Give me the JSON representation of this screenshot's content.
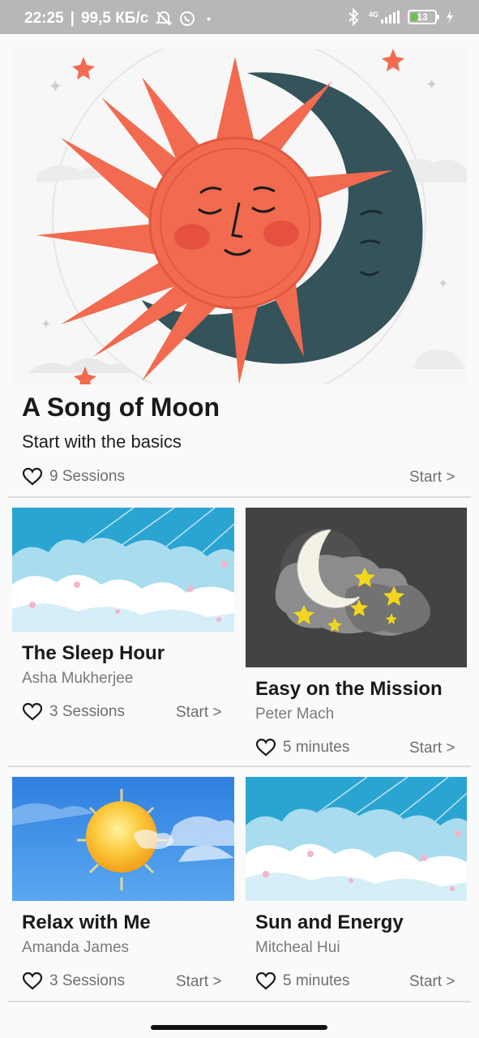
{
  "status_bar": {
    "time": "22:25",
    "speed": "99,5 КБ/с",
    "network": "4G",
    "battery": "13",
    "colors": {
      "bar": "#b7b7b7",
      "battery_fill": "#6cc04a"
    },
    "icons": [
      "silent-bell-icon",
      "whatsapp-icon",
      "bluetooth-icon",
      "signal-icon",
      "battery-icon",
      "charging-icon"
    ]
  },
  "featured": {
    "title": "A Song of Moon",
    "subtitle": "Start with the basics",
    "sessions": "9 Sessions",
    "start": "Start >",
    "image": "sun-and-moon-illustration"
  },
  "cards": [
    {
      "title": "The Sleep Hour",
      "author": "Asha Mukherjee",
      "meta": "3 Sessions",
      "start": "Start >",
      "image": "sky-clouds-illustration"
    },
    {
      "title": "Easy on the Mission",
      "author": "Peter Mach",
      "meta": "5 minutes",
      "start": "Start >",
      "image": "moon-clouds-stars-illustration"
    },
    {
      "title": "Relax with Me",
      "author": "Amanda James",
      "meta": "3 Sessions",
      "start": "Start >",
      "image": "sun-blue-sky-illustration"
    },
    {
      "title": "Sun and Energy",
      "author": "Mitcheal Hui",
      "meta": "5 minutes",
      "start": "Start >",
      "image": "sky-clouds-illustration"
    }
  ],
  "theme": {
    "accent_orange": "#f26a4f",
    "moon_dark": "#34535a",
    "sky_blue": "#2aa5d2"
  }
}
